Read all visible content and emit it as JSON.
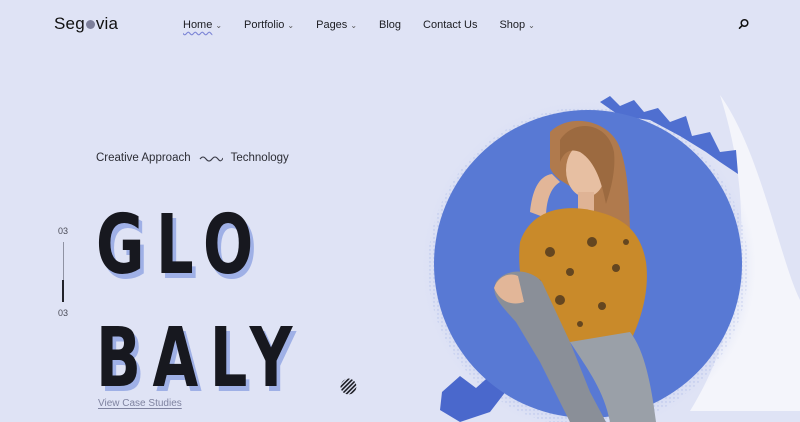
{
  "header": {
    "logo": {
      "part1": "Seg",
      "part2": "via"
    },
    "nav": [
      {
        "label": "Home",
        "active": true,
        "has_dropdown": true
      },
      {
        "label": "Portfolio",
        "active": false,
        "has_dropdown": true
      },
      {
        "label": "Pages",
        "active": false,
        "has_dropdown": true
      },
      {
        "label": "Blog",
        "active": false,
        "has_dropdown": false
      },
      {
        "label": "Contact Us",
        "active": false,
        "has_dropdown": false
      },
      {
        "label": "Shop",
        "active": false,
        "has_dropdown": true
      }
    ],
    "search_icon": "search-icon"
  },
  "hero": {
    "tagline_left": "Creative Approach",
    "tagline_right": "Technology",
    "slide_current": "03",
    "slide_total": "03",
    "headline_line1": "GLO",
    "headline_line2": "BALY",
    "cta": "View Case Studies"
  },
  "colors": {
    "background": "#dfe3f5",
    "circle": "#5879d4",
    "accent_shadow": "#9fb0e6",
    "text": "#17181f"
  }
}
